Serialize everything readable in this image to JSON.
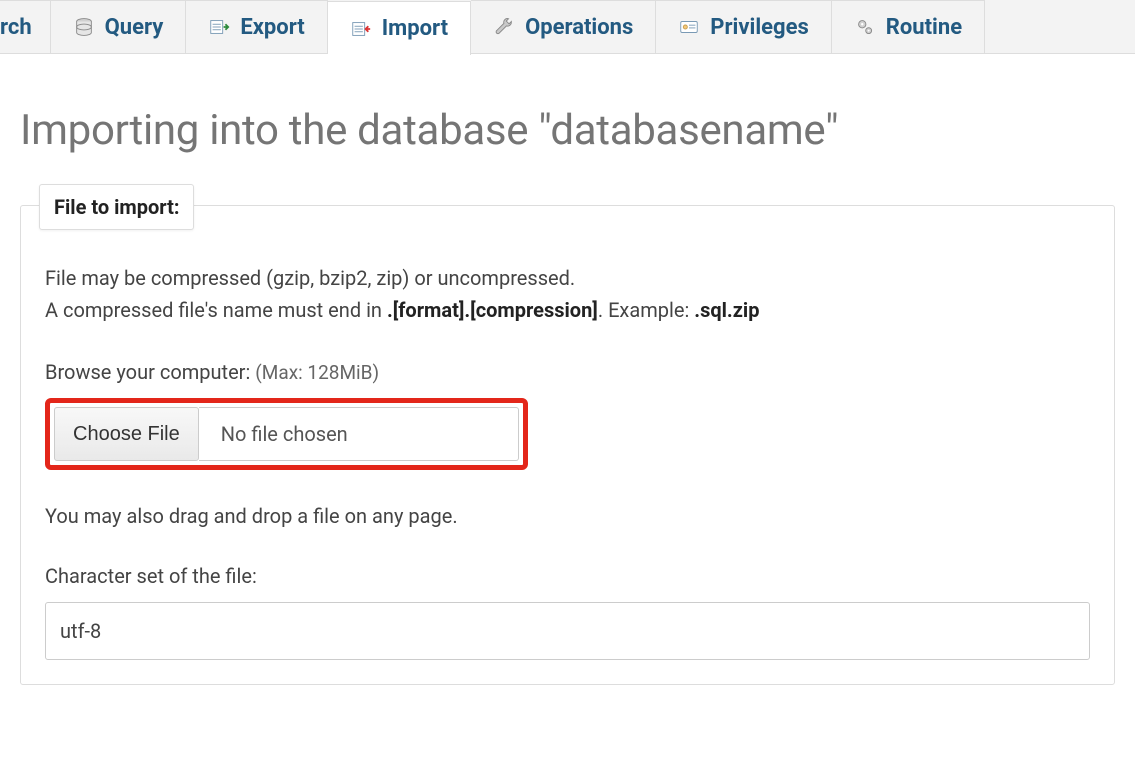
{
  "tabs": {
    "search": "rch",
    "query": "Query",
    "export": "Export",
    "import": "Import",
    "operations": "Operations",
    "privileges": "Privileges",
    "routines": "Routine"
  },
  "page": {
    "title": "Importing into the database \"databasename\""
  },
  "fileImport": {
    "legend": "File to import:",
    "help_line1": "File may be compressed (gzip, bzip2, zip) or uncompressed.",
    "help_line2_pre": "A compressed file's name must end in ",
    "help_line2_fmt": ".[format].[compression]",
    "help_line2_mid": ". Example: ",
    "help_line2_ex": ".sql.zip",
    "browse_label": "Browse your computer: ",
    "browse_max": "(Max: 128MiB)",
    "choose_button": "Choose File",
    "no_file": "No file chosen",
    "drag_text": "You may also drag and drop a file on any page.",
    "charset_label": "Character set of the file:",
    "charset_value": "utf-8"
  }
}
